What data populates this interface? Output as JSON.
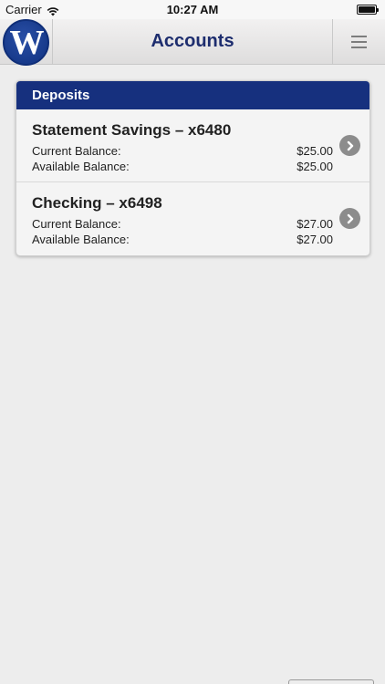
{
  "status_bar": {
    "carrier": "Carrier",
    "time": "10:27 AM",
    "icons": [
      "wifi-icon",
      "battery-icon"
    ]
  },
  "nav": {
    "logo_letter": "W",
    "title": "Accounts",
    "menu_icon": "hamburger-menu-icon"
  },
  "deposits": {
    "header": "Deposits",
    "accounts": [
      {
        "name": "Statement Savings – x6480",
        "current_label": "Current Balance:",
        "current_value": "$25.00",
        "available_label": "Available Balance:",
        "available_value": "$25.00"
      },
      {
        "name": "Checking – x6498",
        "current_label": "Current Balance:",
        "current_value": "$27.00",
        "available_label": "Available Balance:",
        "available_value": "$27.00"
      }
    ]
  },
  "colors": {
    "brand_blue": "#16307e",
    "title_blue": "#1d2d6e",
    "background": "#ededed"
  }
}
